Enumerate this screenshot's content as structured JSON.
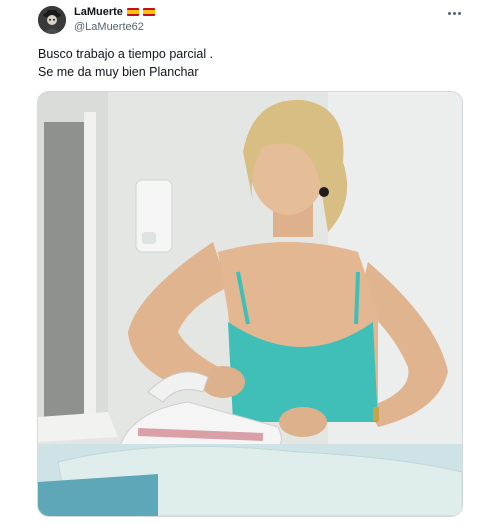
{
  "tweet": {
    "display_name": "LaMuerte",
    "flags": [
      "spain-flag-icon",
      "spain-flag-icon"
    ],
    "handle": "@LaMuerte62",
    "text_lines": [
      "Busco trabajo a tiempo parcial .",
      "Se me da muy bien Planchar"
    ],
    "avatar_icon": "user-avatar-icon",
    "more_icon": "more-options-icon",
    "media_description_icon": "photo-icon"
  },
  "colors": {
    "text": "#0f1419",
    "secondary": "#536471",
    "border": "#cfd9de",
    "flag_red": "#c60b1e",
    "flag_yellow": "#ffc400",
    "top_color": "#3fbfb8"
  }
}
